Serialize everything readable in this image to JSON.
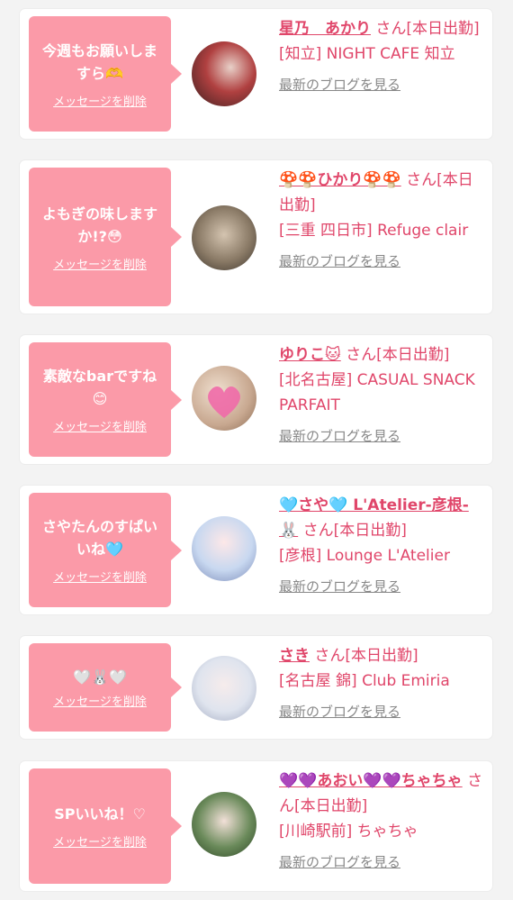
{
  "cards": [
    {
      "message": "今週もお願いしますら🫶",
      "delete_label": "メッセージを削除",
      "name": "星乃　あかり",
      "suffix": " さん[本日出勤]",
      "shop": "[知立] NIGHT CAFE 知立",
      "blog_label": "最新のブログを見る"
    },
    {
      "message": "よもぎの味しますか!?😳",
      "delete_label": "メッセージを削除",
      "name": "🍄🍄ひかり🍄🍄",
      "suffix": " さん[本日出勤]",
      "shop": "[三重 四日市] Refuge clair",
      "blog_label": "最新のブログを見る"
    },
    {
      "message": "素敵なbarですね😊",
      "delete_label": "メッセージを削除",
      "name": "ゆりこ🐱",
      "suffix": " さん[本日出勤]",
      "shop": "[北名古屋] CASUAL SNACK PARFAIT",
      "blog_label": "最新のブログを見る"
    },
    {
      "message": "さやたんのすぱいいね🩵",
      "delete_label": "メッセージを削除",
      "name": "🩵さや🩵 L'Atelier-彦根-🐰",
      "suffix": " さん[本日出勤]",
      "shop": "[彦根] Lounge L'Atelier",
      "blog_label": "最新のブログを見る"
    },
    {
      "message": "🤍🐰🤍",
      "delete_label": "メッセージを削除",
      "name": "さき",
      "suffix": " さん[本日出勤]",
      "shop": "[名古屋 錦] Club Emiria",
      "blog_label": "最新のブログを見る"
    },
    {
      "message": "SPいいね！♡",
      "delete_label": "メッセージを削除",
      "name": "💜💜あおい💜💜ちゃちゃ",
      "suffix": " さん[本日出勤]",
      "shop": "[川崎駅前] ちゃちゃ",
      "blog_label": "最新のブログを見る"
    }
  ],
  "colors": {
    "bubble": "#fb9aa8",
    "accent": "#e0466a",
    "muted": "#888888"
  }
}
